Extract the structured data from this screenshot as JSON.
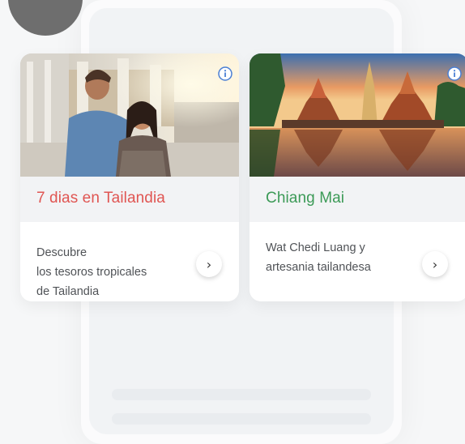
{
  "cards": [
    {
      "title": "7 dias en Tailandia",
      "title_color": "#e05552",
      "description": "Descubre\nlos tesoros tropicales\nde Tailandia",
      "image": "travelers-at-thai-temple-photo",
      "info_icon": "info-icon",
      "action_icon": "chevron-right-icon"
    },
    {
      "title": "Chiang Mai",
      "title_color": "#3c9a57",
      "description": "Wat Chedi Luang y\nartesania tailandesa",
      "image": "chiang-mai-temple-sunset-photo",
      "info_icon": "info-icon",
      "action_icon": "chevron-right-icon"
    }
  ],
  "arrow_glyph": "›"
}
